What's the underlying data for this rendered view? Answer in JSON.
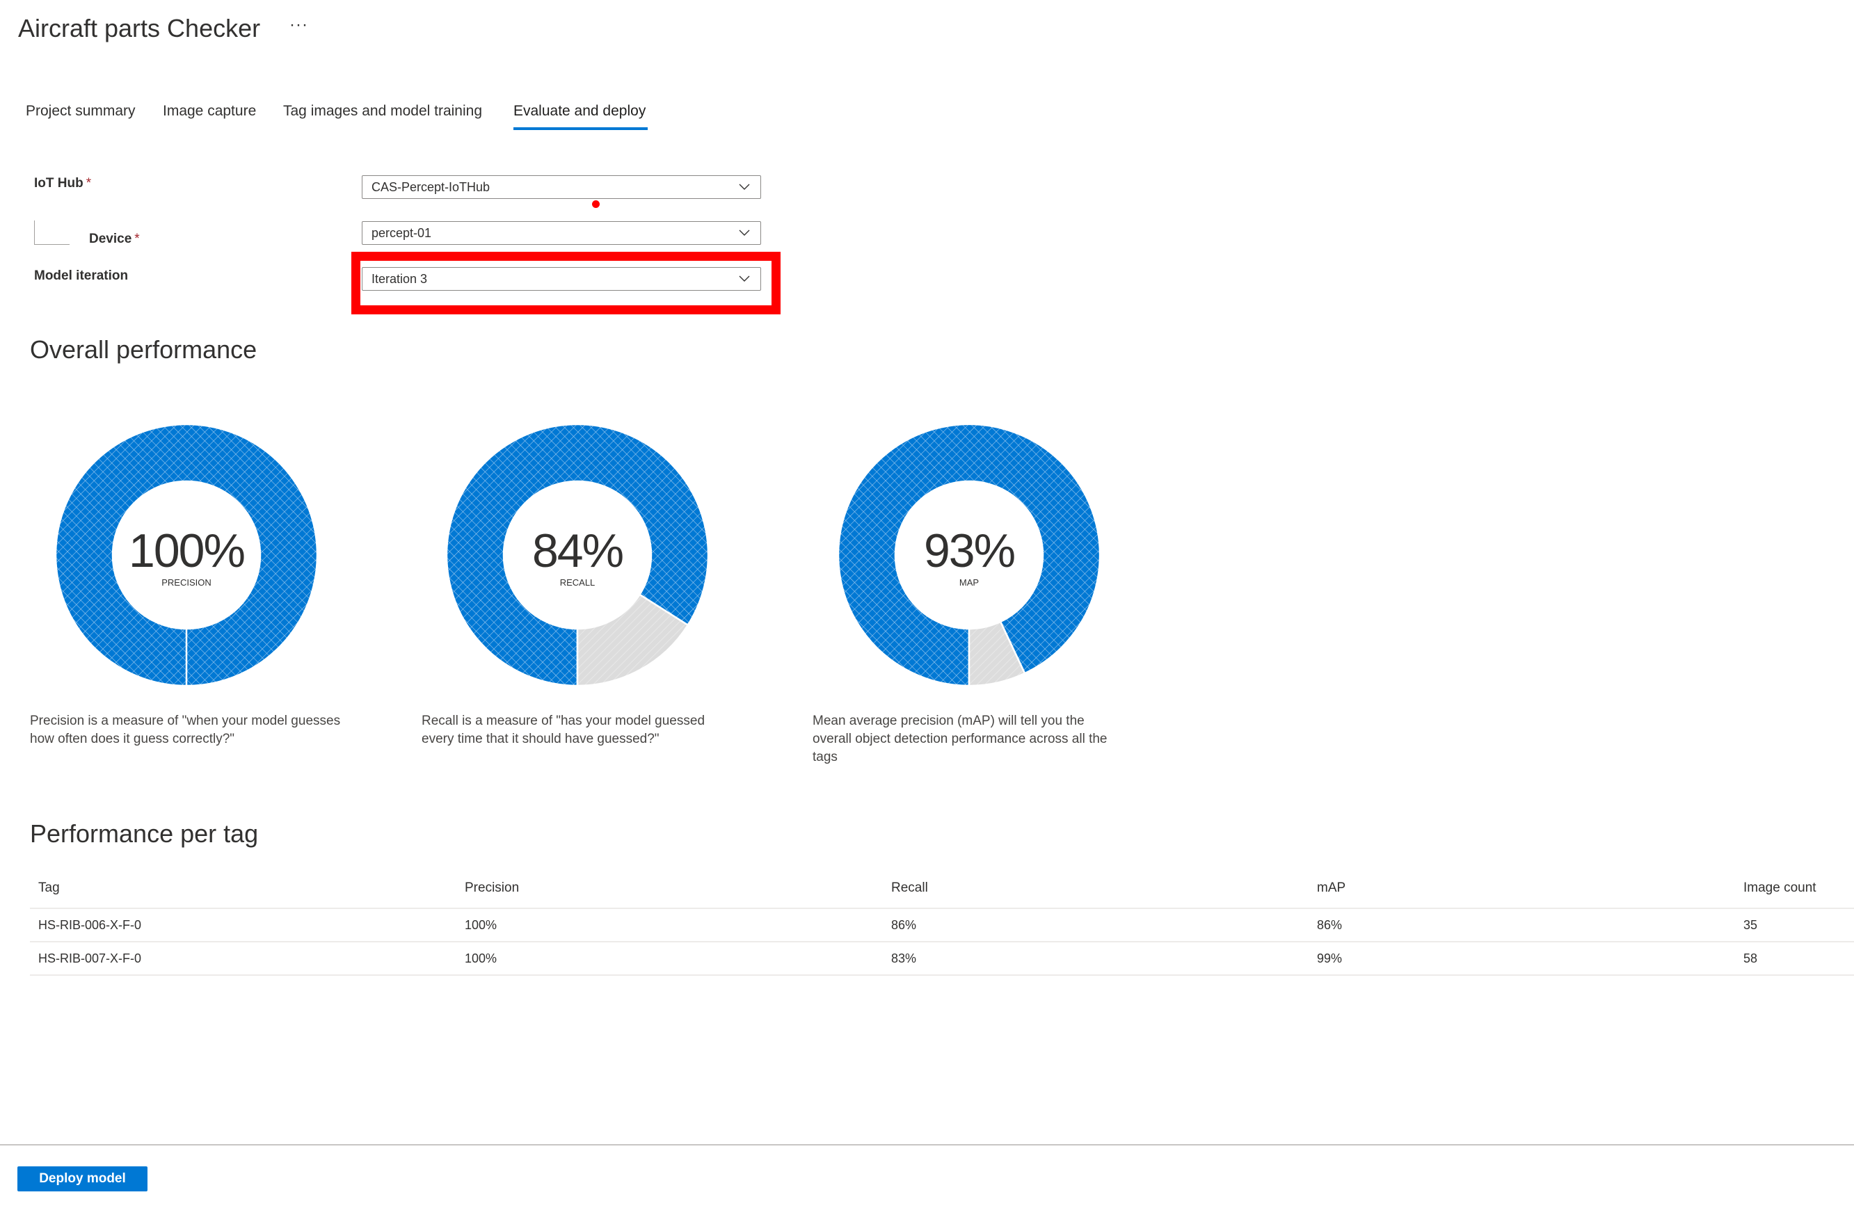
{
  "header": {
    "title": "Aircraft parts Checker",
    "more_label": "···"
  },
  "tabs": [
    {
      "label": "Project summary",
      "active": false
    },
    {
      "label": "Image capture",
      "active": false
    },
    {
      "label": "Tag images and model training",
      "active": false
    },
    {
      "label": "Evaluate and deploy",
      "active": true
    }
  ],
  "form": {
    "required_marker": "*",
    "iot_hub": {
      "label": "IoT Hub",
      "value": "CAS-Percept-IoTHub"
    },
    "device": {
      "label": "Device",
      "value": "percept-01"
    },
    "model_iteration": {
      "label": "Model iteration",
      "value": "Iteration 3"
    }
  },
  "overall": {
    "heading": "Overall performance",
    "descriptions": [
      "Precision is a measure of \"when your model guesses how often does it guess correctly?\"",
      "Recall is a measure of \"has your model guessed every time that it should have guessed?\"",
      "Mean average precision (mAP) will tell you the overall object detection performance across all the tags"
    ]
  },
  "colors": {
    "accent": "#0078d4",
    "remainder": "#dcdcdc",
    "highlight": "#ff0000"
  },
  "chart_data": [
    {
      "type": "pie",
      "title": "PRECISION",
      "center_label": "100%",
      "categories": [
        "value",
        "remainder"
      ],
      "values": [
        100,
        0
      ]
    },
    {
      "type": "pie",
      "title": "RECALL",
      "center_label": "84%",
      "categories": [
        "value",
        "remainder"
      ],
      "values": [
        84,
        16
      ]
    },
    {
      "type": "pie",
      "title": "MAP",
      "center_label": "93%",
      "categories": [
        "value",
        "remainder"
      ],
      "values": [
        93,
        7
      ]
    }
  ],
  "per_tag": {
    "heading": "Performance per tag",
    "columns": [
      "Tag",
      "Precision",
      "Recall",
      "mAP",
      "Image count"
    ],
    "rows": [
      [
        "HS-RIB-006-X-F-0",
        "100%",
        "86%",
        "86%",
        "35"
      ],
      [
        "HS-RIB-007-X-F-0",
        "100%",
        "83%",
        "99%",
        "58"
      ]
    ]
  },
  "footer": {
    "deploy_label": "Deploy model"
  }
}
